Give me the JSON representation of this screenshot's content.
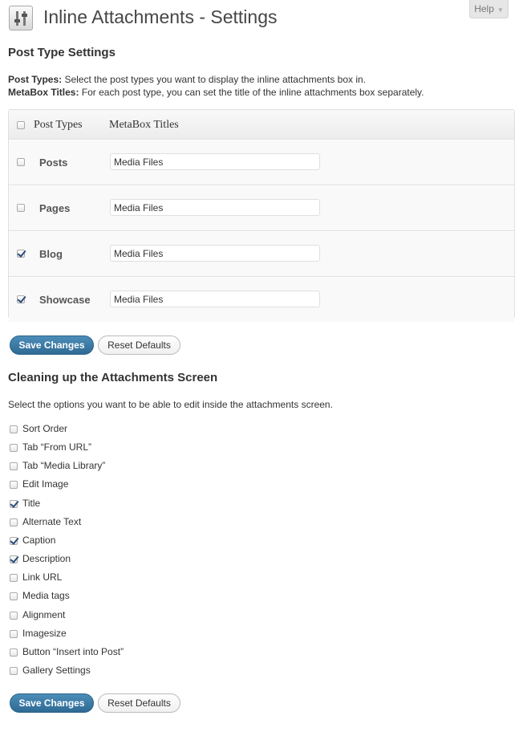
{
  "help_tab": {
    "label": "Help"
  },
  "page": {
    "title": "Inline Attachments - Settings"
  },
  "post_type_section": {
    "heading": "Post Type Settings",
    "desc1_bold": "Post Types:",
    "desc1_text": " Select the post types you want to display the inline attachments box in.",
    "desc2_bold": "MetaBox Titles:",
    "desc2_text": " For each post type, you can set the title of the inline attachments box separately.",
    "table": {
      "col1": "Post Types",
      "col2": "MetaBox Titles",
      "rows": [
        {
          "label": "Posts",
          "value": "Media Files",
          "checked": false
        },
        {
          "label": "Pages",
          "value": "Media Files",
          "checked": false
        },
        {
          "label": "Blog",
          "value": "Media Files",
          "checked": true
        },
        {
          "label": "Showcase",
          "value": "Media Files",
          "checked": true
        }
      ]
    }
  },
  "buttons": {
    "save": "Save Changes",
    "reset": "Reset Defaults"
  },
  "attachments_section": {
    "heading": "Cleaning up the Attachments Screen",
    "desc": "Select the options you want to be able to edit inside the attachments screen.",
    "options": [
      {
        "label": "Sort Order",
        "checked": false
      },
      {
        "label": "Tab “From URL”",
        "checked": false
      },
      {
        "label": "Tab “Media Library”",
        "checked": false
      },
      {
        "label": "Edit Image",
        "checked": false
      },
      {
        "label": "Title",
        "checked": true
      },
      {
        "label": "Alternate Text",
        "checked": false
      },
      {
        "label": "Caption",
        "checked": true
      },
      {
        "label": "Description",
        "checked": true
      },
      {
        "label": "Link URL",
        "checked": false
      },
      {
        "label": "Media tags",
        "checked": false
      },
      {
        "label": "Alignment",
        "checked": false
      },
      {
        "label": "Imagesize",
        "checked": false
      },
      {
        "label": "Button “Insert into Post”",
        "checked": false
      },
      {
        "label": "Gallery Settings",
        "checked": false
      }
    ]
  },
  "colors": {
    "primary_button": "#2e6a94",
    "check_mark": "#2a4d7a"
  }
}
